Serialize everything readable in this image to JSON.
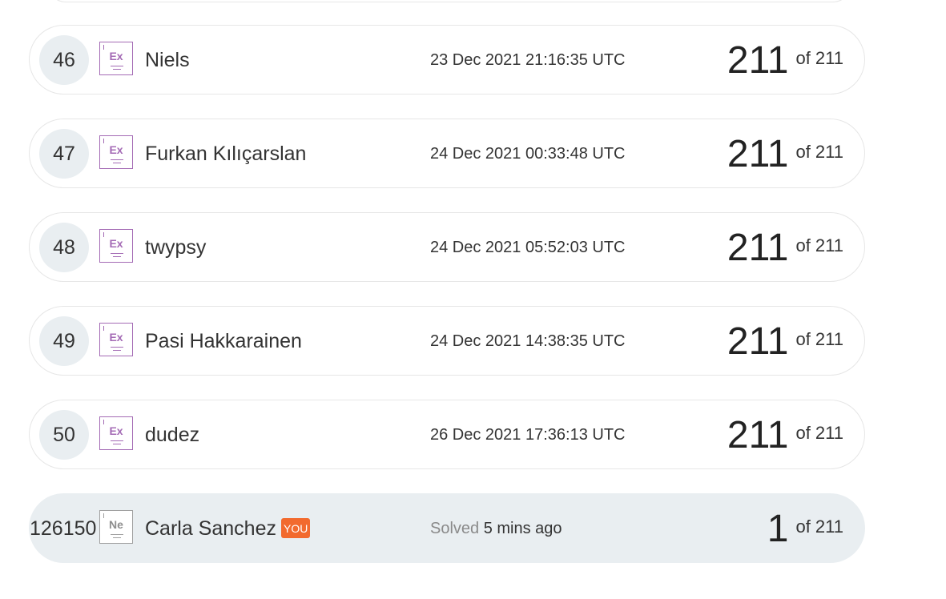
{
  "rows": [
    {
      "rank": "46",
      "badge": "Ex",
      "name": "Niels",
      "time": "23 Dec 2021 21:16:35 UTC",
      "score": "211",
      "of": "of 211"
    },
    {
      "rank": "47",
      "badge": "Ex",
      "name": "Furkan Kılıçarslan",
      "time": "24 Dec 2021 00:33:48 UTC",
      "score": "211",
      "of": "of 211"
    },
    {
      "rank": "48",
      "badge": "Ex",
      "name": "twypsy",
      "time": "24 Dec 2021 05:52:03 UTC",
      "score": "211",
      "of": "of 211"
    },
    {
      "rank": "49",
      "badge": "Ex",
      "name": "Pasi Hakkarainen",
      "time": "24 Dec 2021 14:38:35 UTC",
      "score": "211",
      "of": "of 211"
    },
    {
      "rank": "50",
      "badge": "Ex",
      "name": "dudez",
      "time": "26 Dec 2021 17:36:13 UTC",
      "score": "211",
      "of": "of 211"
    }
  ],
  "current_user": {
    "rank": "126150",
    "badge": "Ne",
    "name": "Carla Sanchez",
    "you_label": "YOU",
    "solved_prefix": "Solved",
    "solved_time": "5 mins ago",
    "score": "1",
    "of": "of 211"
  },
  "colors": {
    "badge_purple": "#a46bb5",
    "badge_gray": "#a0a0a0",
    "you_tag": "#f26a2e",
    "highlight_row": "#e9eef1"
  }
}
